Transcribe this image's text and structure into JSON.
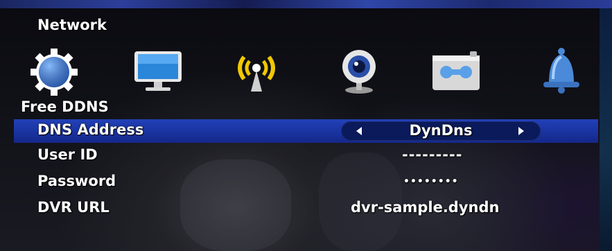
{
  "header": {
    "title": "Network"
  },
  "icons": [
    "gear-icon",
    "monitor-icon",
    "wireless-antenna-icon",
    "webcam-icon",
    "recorder-icon",
    "bell-icon"
  ],
  "section": {
    "title": "Free DDNS"
  },
  "settings": {
    "dns_address": {
      "label": "DNS Address",
      "value": "DynDns"
    },
    "user_id": {
      "label": "User ID",
      "value": "---------"
    },
    "password": {
      "label": "Password",
      "value": "••••••••"
    },
    "dvr_url": {
      "label": "DVR URL",
      "value": "dvr-sample.dyndn"
    }
  },
  "colors": {
    "highlight_row": "#1c38aa",
    "selector_bg": "#0a1a5a",
    "text": "#ffffff"
  }
}
